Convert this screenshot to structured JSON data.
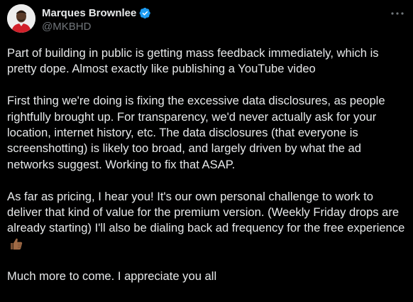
{
  "author": {
    "display_name": "Marques Brownlee",
    "handle": "@MKBHD",
    "verified": true,
    "verified_color": "#1d9bf0"
  },
  "more_icon": "more-horizontal-icon",
  "post": {
    "paragraphs": [
      "Part of building in public is getting mass feedback immediately, which is pretty dope. Almost exactly like publishing a YouTube video",
      "First thing we're doing is fixing the excessive data disclosures, as people rightfully brought up. For transparency, we'd never actually ask for your location, internet history, etc. The data disclosures (that everyone is screenshotting) is likely too broad, and largely driven by what the ad networks suggest. Working to fix that ASAP.",
      "As far as pricing, I hear you! It's our own personal challenge to work to deliver that kind of value for the premium version. (Weekly Friday drops are already starting) I'll also be dialing back ad frequency for the free experience",
      "Much more to come. I appreciate you all"
    ],
    "emoji": "thumbs-up-icon"
  },
  "colors": {
    "background": "#000000",
    "text": "#e7e9ea",
    "secondary_text": "#71767b"
  }
}
